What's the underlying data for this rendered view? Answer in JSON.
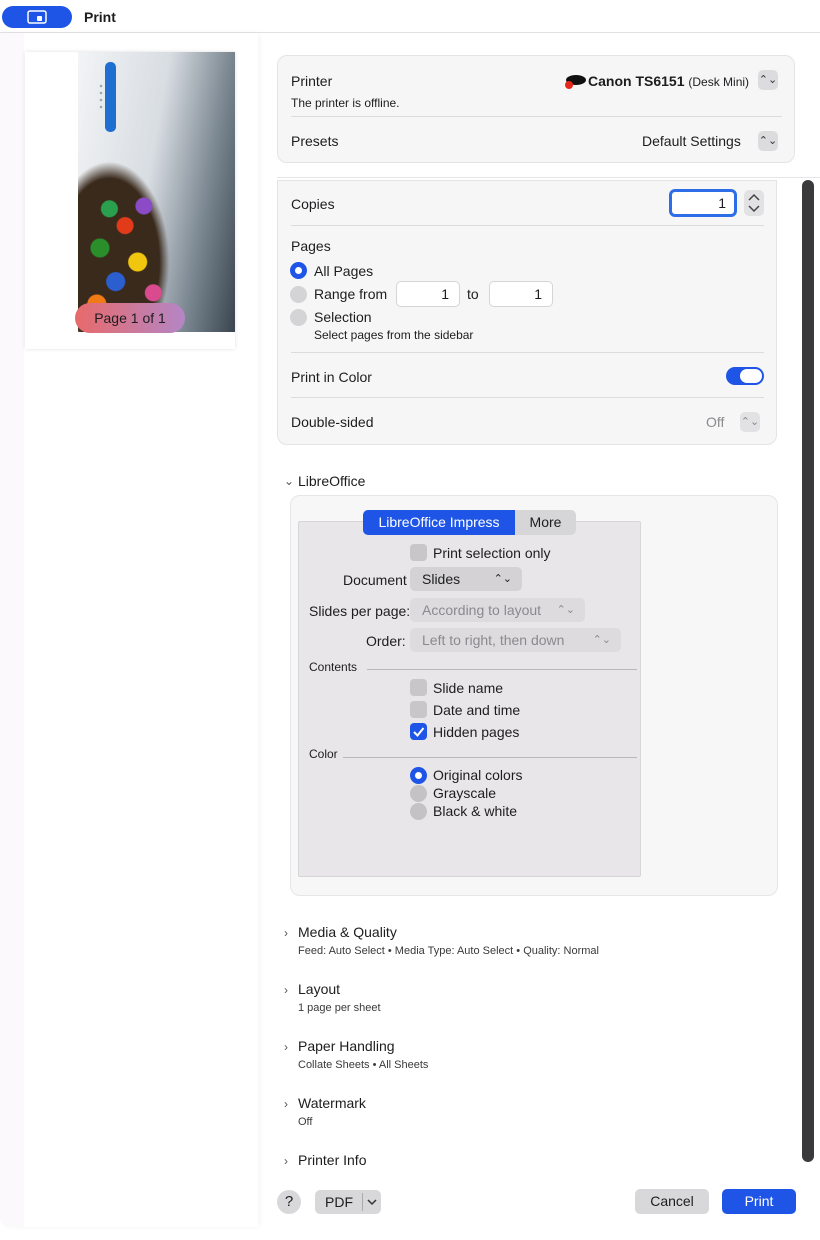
{
  "window": {
    "title": "Print"
  },
  "preview": {
    "page_badge": "Page 1 of 1"
  },
  "printer": {
    "label": "Printer",
    "name": "Canon TS6151",
    "name_detail": "(Desk Mini)",
    "status": "The printer is offline.",
    "presets_label": "Presets",
    "presets_value": "Default Settings"
  },
  "options": {
    "copies_label": "Copies",
    "copies_value": "1",
    "pages_label": "Pages",
    "all_pages": "All Pages",
    "range_from": "Range from",
    "range_from_value": "1",
    "range_to": "to",
    "range_to_value": "1",
    "selection": "Selection",
    "selection_hint": "Select pages from the sidebar",
    "print_in_color": "Print in Color",
    "double_sided": "Double-sided",
    "double_sided_value": "Off"
  },
  "libreoffice": {
    "section_title": "LibreOffice",
    "tab_impress": "LibreOffice Impress",
    "tab_more": "More",
    "print_selection_only": "Print selection only",
    "document_label": "Document",
    "document_value": "Slides",
    "slides_per_page_label": "Slides per page:",
    "slides_per_page_value": "According to layout",
    "order_label": "Order:",
    "order_value": "Left to right, then down",
    "contents_label": "Contents",
    "slide_name": "Slide name",
    "date_and_time": "Date and time",
    "hidden_pages": "Hidden pages",
    "color_label": "Color",
    "original_colors": "Original colors",
    "grayscale": "Grayscale",
    "black_white": "Black & white"
  },
  "sections": [
    {
      "title": "Media & Quality",
      "subtitle": "Feed: Auto Select • Media Type: Auto Select • Quality: Normal"
    },
    {
      "title": "Layout",
      "subtitle": "1 page per sheet"
    },
    {
      "title": "Paper Handling",
      "subtitle": "Collate Sheets • All Sheets"
    },
    {
      "title": "Watermark",
      "subtitle": "Off"
    },
    {
      "title": "Printer Info",
      "subtitle": ""
    }
  ],
  "footer": {
    "help": "?",
    "pdf": "PDF",
    "cancel": "Cancel",
    "print": "Print"
  },
  "colors": {
    "accent": "#1f55e6"
  }
}
